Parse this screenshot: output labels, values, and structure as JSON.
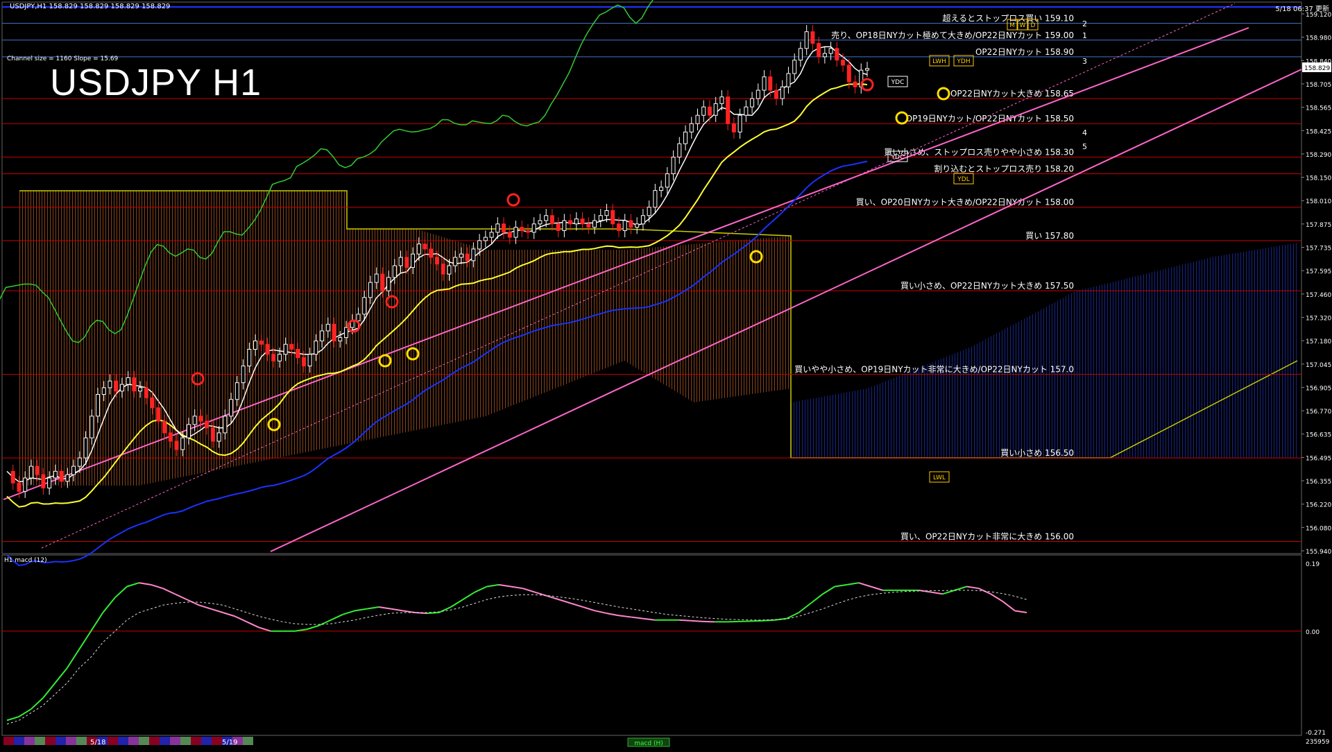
{
  "header": {
    "symbol_line": "USDJPY,H1  158.829 158.829 158.829 158.829",
    "title": "USDJPY H1",
    "channel_info": "Channel size = 1160 Slope = 15.69",
    "datetime": "5/18 06:37 更新",
    "macd_label": "H1  macd (12)",
    "macd_footer": "macd (H)",
    "counter": "235959"
  },
  "colors": {
    "background": "#000000",
    "level_line": "#cc0000",
    "channel": "#ff66cc",
    "ma_white": "#ffffff",
    "ma_yellow": "#ffff33",
    "ma_blue": "#1a33ff",
    "chikou": "#33cc33",
    "cloud_orange": "#aa5522",
    "cloud_blue": "#1a2a99",
    "bull_candle": "#ffffff",
    "bear_candle": "#ff2222",
    "macd_green": "#33ee33",
    "macd_pink": "#ff88cc"
  },
  "levels": [
    {
      "text": "超えるとストップロス買い 159.10",
      "price": 159.1
    },
    {
      "text": "売り、OP18日NYカット極めて大きめ/OP22日NYカット 159.00",
      "price": 159.0
    },
    {
      "text": "OP22日NYカット 158.90",
      "price": 158.9
    },
    {
      "text": "OP22日NYカット大きめ 158.65",
      "price": 158.65
    },
    {
      "text": "OP19日NYカット/OP22日NYカット 158.50",
      "price": 158.5
    },
    {
      "text": "買い小さめ、ストップロス売りやや小さめ 158.30",
      "price": 158.3
    },
    {
      "text": "割り込むとストップロス売り 158.20",
      "price": 158.2
    },
    {
      "text": "買い、OP20日NYカット大きめ/OP22日NYカット 158.00",
      "price": 158.0
    },
    {
      "text": "買い 157.80",
      "price": 157.8
    },
    {
      "text": "買い小さめ、OP22日NYカット大きめ 157.50",
      "price": 157.5
    },
    {
      "text": "買いやや小さめ、OP19日NYカット非常に大きめ/OP22日NYカット 157.0",
      "price": 157.0
    },
    {
      "text": "買い小さめ 156.50",
      "price": 156.5
    },
    {
      "text": "買い、OP22日NYカット非常に大きめ 156.00",
      "price": 156.0
    }
  ],
  "price_axis_ticks": [
    "159.120",
    "158.980",
    "158.840",
    "158.705",
    "158.565",
    "158.425",
    "158.290",
    "158.150",
    "158.010",
    "157.875",
    "157.735",
    "157.595",
    "157.460",
    "157.320",
    "157.180",
    "157.045",
    "156.905",
    "156.770",
    "156.635",
    "156.495",
    "156.355",
    "156.220",
    "156.080",
    "155.940"
  ],
  "current_price": "158.829",
  "macd_axis_ticks": [
    "0.19",
    "0.00",
    "-0.271"
  ],
  "markers": [
    "YDC",
    "YDC",
    "YDH",
    "LWH",
    "YDL",
    "LWL",
    "W",
    "D",
    "M"
  ],
  "channel_numbers": [
    "1",
    "2",
    "3",
    "4",
    "5"
  ],
  "bottom_dates": [
    "5/18",
    "5/19"
  ],
  "chart_data": {
    "type": "candlestick",
    "title": "USDJPY H1",
    "ylim": [
      155.94,
      159.19
    ],
    "macd_ylim": [
      -0.271,
      0.19
    ],
    "grid": false,
    "closes": [
      156.42,
      156.35,
      156.3,
      156.38,
      156.45,
      156.4,
      156.32,
      156.38,
      156.42,
      156.36,
      156.4,
      156.45,
      156.5,
      156.62,
      156.75,
      156.88,
      156.92,
      156.96,
      156.9,
      156.94,
      156.98,
      156.9,
      156.92,
      156.86,
      156.8,
      156.72,
      156.65,
      156.6,
      156.55,
      156.62,
      156.7,
      156.75,
      156.72,
      156.68,
      156.6,
      156.65,
      156.75,
      156.85,
      156.95,
      157.05,
      157.15,
      157.2,
      157.18,
      157.12,
      157.08,
      157.12,
      157.18,
      157.15,
      157.1,
      157.05,
      157.12,
      157.2,
      157.26,
      157.3,
      157.2,
      157.22,
      157.28,
      157.32,
      157.36,
      157.46,
      157.55,
      157.6,
      157.5,
      157.58,
      157.65,
      157.7,
      157.64,
      157.72,
      157.78,
      157.75,
      157.7,
      157.66,
      157.6,
      157.65,
      157.7,
      157.72,
      157.68,
      157.75,
      157.8,
      157.82,
      157.85,
      157.9,
      157.85,
      157.82,
      157.88,
      157.86,
      157.85,
      157.9,
      157.92,
      157.95,
      157.9,
      157.86,
      157.92,
      157.9,
      157.93,
      157.9,
      157.88,
      157.92,
      157.95,
      157.98,
      157.9,
      157.86,
      157.92,
      157.88,
      157.9,
      157.95,
      158.0,
      158.1,
      158.12,
      158.2,
      158.3,
      158.38,
      158.45,
      158.5,
      158.55,
      158.6,
      158.55,
      158.62,
      158.66,
      158.5,
      158.45,
      158.55,
      158.6,
      158.65,
      158.7,
      158.78,
      158.7,
      158.65,
      158.72,
      158.8,
      158.88,
      158.95,
      159.05,
      158.98,
      158.9,
      158.92,
      158.95,
      158.88,
      158.85,
      158.75,
      158.72,
      158.82,
      158.83
    ],
    "macd": [
      -0.24,
      -0.23,
      -0.21,
      -0.18,
      -0.14,
      -0.1,
      -0.05,
      0.0,
      0.05,
      0.09,
      0.12,
      0.13,
      0.125,
      0.115,
      0.1,
      0.085,
      0.07,
      0.06,
      0.05,
      0.04,
      0.025,
      0.01,
      0.0,
      0.0,
      0.0,
      0.005,
      0.015,
      0.03,
      0.045,
      0.055,
      0.06,
      0.065,
      0.06,
      0.055,
      0.05,
      0.048,
      0.05,
      0.065,
      0.085,
      0.105,
      0.12,
      0.125,
      0.12,
      0.115,
      0.105,
      0.095,
      0.085,
      0.075,
      0.065,
      0.055,
      0.048,
      0.042,
      0.038,
      0.034,
      0.03,
      0.03,
      0.03,
      0.028,
      0.026,
      0.025,
      0.025,
      0.026,
      0.027,
      0.028,
      0.03,
      0.034,
      0.05,
      0.075,
      0.1,
      0.12,
      0.125,
      0.13,
      0.12,
      0.11,
      0.11,
      0.11,
      0.11,
      0.105,
      0.1,
      0.11,
      0.12,
      0.115,
      0.1,
      0.08,
      0.055,
      0.05
    ],
    "macd_signal": [
      -0.25,
      -0.24,
      -0.22,
      -0.2,
      -0.17,
      -0.14,
      -0.1,
      -0.07,
      -0.03,
      0.0,
      0.03,
      0.05,
      0.06,
      0.07,
      0.075,
      0.078,
      0.078,
      0.075,
      0.07,
      0.06,
      0.05,
      0.04,
      0.032,
      0.025,
      0.02,
      0.018,
      0.018,
      0.02,
      0.025,
      0.03,
      0.037,
      0.043,
      0.048,
      0.05,
      0.05,
      0.05,
      0.052,
      0.057,
      0.065,
      0.075,
      0.085,
      0.092,
      0.096,
      0.098,
      0.098,
      0.096,
      0.092,
      0.088,
      0.083,
      0.077,
      0.071,
      0.065,
      0.06,
      0.055,
      0.05,
      0.045,
      0.042,
      0.039,
      0.036,
      0.034,
      0.032,
      0.031,
      0.03,
      0.03,
      0.031,
      0.033,
      0.04,
      0.05,
      0.06,
      0.072,
      0.083,
      0.092,
      0.098,
      0.102,
      0.105,
      0.107,
      0.108,
      0.109,
      0.109,
      0.11,
      0.11,
      0.109,
      0.106,
      0.101,
      0.094,
      0.085
    ]
  }
}
